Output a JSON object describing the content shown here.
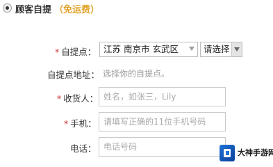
{
  "header": {
    "title": "顾客自提",
    "free_note": "（免运费）"
  },
  "form": {
    "pickup_point": {
      "label": "自提点：",
      "location_value": "江苏 南京市 玄武区",
      "sub_select_value": "请选择"
    },
    "pickup_address": {
      "label": "自提点地址：",
      "hint": "选择你的自提点。"
    },
    "recipient": {
      "label": "收货人：",
      "placeholder": "姓名，如张三，Lily"
    },
    "mobile": {
      "label": "手机：",
      "placeholder": "请填写正确的11位手机号码"
    },
    "phone": {
      "label": "电话：",
      "placeholder": "电话号码"
    },
    "required_mark": "*"
  },
  "watermark": {
    "text": "大神手游网"
  }
}
